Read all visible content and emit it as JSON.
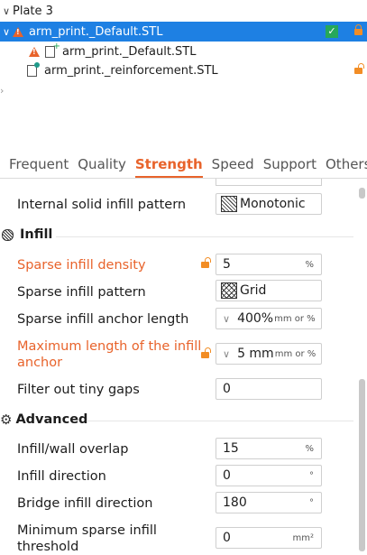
{
  "tree": {
    "plate": "Plate 3",
    "object": "arm_print._Default.STL",
    "part1": "arm_print._Default.STL",
    "part2": "arm_print._reinforcement.STL"
  },
  "tabs": [
    "Frequent",
    "Quality",
    "Strength",
    "Speed",
    "Support",
    "Others"
  ],
  "params": {
    "internal_solid_infill_pattern": {
      "label": "Internal solid infill pattern",
      "value": "Monotonic"
    },
    "infill_section": "Infill",
    "sparse_infill_density": {
      "label": "Sparse infill density",
      "value": "5",
      "unit": "%"
    },
    "sparse_infill_pattern": {
      "label": "Sparse infill pattern",
      "value": "Grid"
    },
    "sparse_infill_anchor_length": {
      "label": "Sparse infill anchor length",
      "value": "400%",
      "unit": "mm or %"
    },
    "max_infill_anchor": {
      "label": "Maximum length of the infill anchor",
      "value": "5 mm",
      "unit": "mm or %"
    },
    "filter_tiny_gaps": {
      "label": "Filter out tiny gaps",
      "value": "0"
    },
    "advanced_section": "Advanced",
    "infill_wall_overlap": {
      "label": "Infill/wall overlap",
      "value": "15",
      "unit": "%"
    },
    "infill_direction": {
      "label": "Infill direction",
      "value": "0",
      "unit": "°"
    },
    "bridge_infill_direction": {
      "label": "Bridge infill direction",
      "value": "180",
      "unit": "°"
    },
    "min_sparse_infill_threshold": {
      "label": "Minimum sparse infill threshold",
      "value": "0",
      "unit": "mm²"
    }
  },
  "colors": {
    "accent": "#e8632b",
    "selection": "#1e80e3",
    "lock": "#f28d25",
    "check": "#26a85a"
  }
}
